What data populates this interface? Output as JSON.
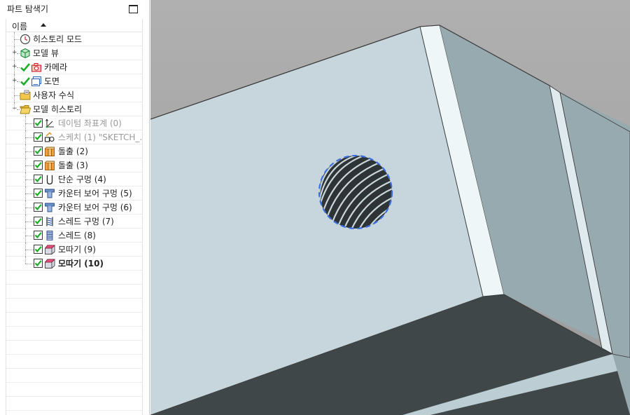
{
  "panel": {
    "title": "파트 탐색기"
  },
  "tree": {
    "column_header": "이름",
    "items": [
      {
        "label": "히스토리 모드",
        "icon": "history-clock-icon"
      },
      {
        "label": "모델 뷰",
        "icon": "model-view-cube-icon"
      },
      {
        "label": "카메라",
        "icon": "camera-icon"
      },
      {
        "label": "도면",
        "icon": "drawing-icon"
      },
      {
        "label": "사용자 수식",
        "icon": "folder-expression-icon"
      },
      {
        "label": "모델 히스토리",
        "icon": "folder-open-icon"
      },
      {
        "label": "데이텀 좌표계 (0)",
        "icon": "datum-csys-icon"
      },
      {
        "label": "스케치 (1) \"SKETCH_...",
        "icon": "sketch-icon"
      },
      {
        "label": "돌출 (2)",
        "icon": "extrude-icon"
      },
      {
        "label": "돌출 (3)",
        "icon": "extrude-icon"
      },
      {
        "label": "단순 구멍 (4)",
        "icon": "simple-hole-icon"
      },
      {
        "label": "카운터 보어 구멍 (5)",
        "icon": "counterbore-hole-icon"
      },
      {
        "label": "카운터 보어 구멍 (6)",
        "icon": "counterbore-hole-icon"
      },
      {
        "label": "스레드 구멍 (7)",
        "icon": "threaded-hole-icon"
      },
      {
        "label": "스레드 (8)",
        "icon": "thread-icon"
      },
      {
        "label": "모따기 (9)",
        "icon": "chamfer-icon"
      },
      {
        "label": "모따기 (10)",
        "icon": "chamfer-icon"
      }
    ]
  },
  "colors": {
    "check_green": "#1fae2b",
    "face_light": "#c6d6dc",
    "face_side": "#97aab0",
    "face_dark": "#3f4749",
    "background": "#ababab",
    "selection_blue": "#3b6ee0"
  }
}
